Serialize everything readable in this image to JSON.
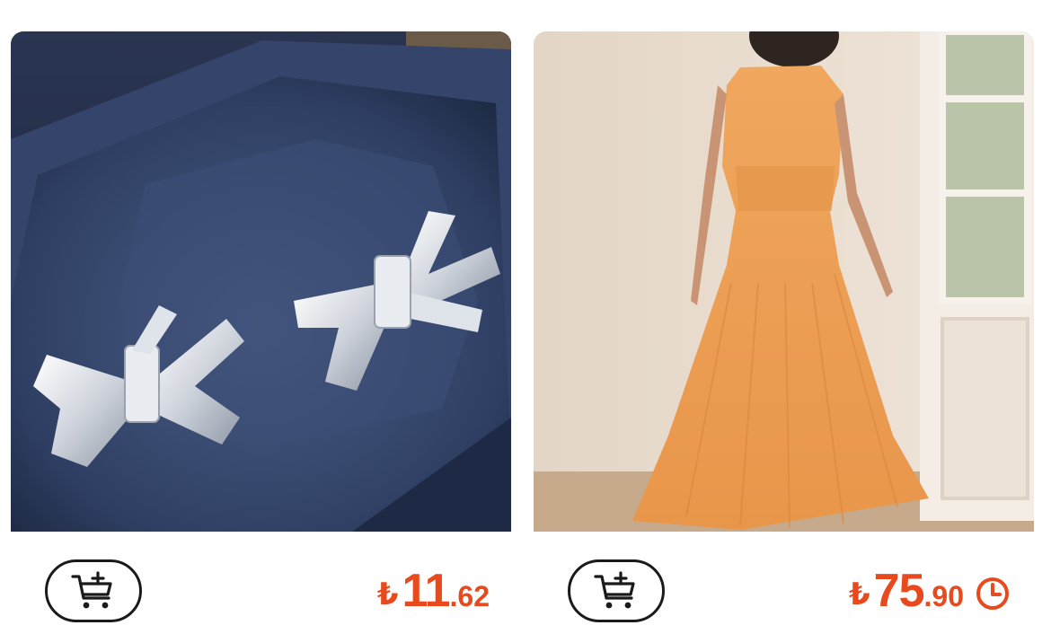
{
  "products": [
    {
      "image_alt": "Bow earrings",
      "currency_symbol": "₺",
      "price_int": "11",
      "price_dec": ".62",
      "cart_icon": "add-to-cart-icon",
      "has_clock": false
    },
    {
      "image_alt": "Orange maxi dress",
      "currency_symbol": "₺",
      "price_int": "75",
      "price_dec": ".90",
      "cart_icon": "add-to-cart-icon",
      "has_clock": true,
      "clock_icon": "clock-icon"
    }
  ],
  "colors": {
    "price": "#e8491d",
    "button_border": "#1a1a1a",
    "background": "#ffffff"
  }
}
